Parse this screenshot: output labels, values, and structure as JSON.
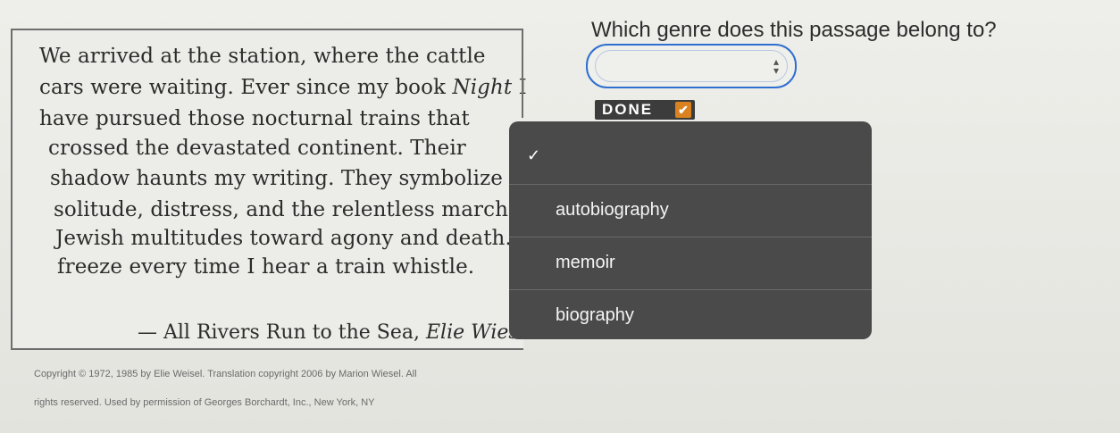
{
  "passage": {
    "lines": [
      {
        "plain": "We arrived at the station, where the cattle"
      },
      {
        "plain": "cars were waiting. Ever since my book ",
        "italic": "Night",
        "after": " I"
      },
      {
        "plain": "have pursued those nocturnal trains that"
      },
      {
        "plain": "crossed the devastated continent. Their"
      },
      {
        "plain": "shadow haunts my writing. They symbolize"
      },
      {
        "plain": "solitude, distress, and the relentless march o"
      },
      {
        "plain": "Jewish multitudes toward agony and death."
      },
      {
        "plain": "freeze every time I hear a train whistle."
      }
    ],
    "attribution_prefix": "— All Rivers Run to the Sea, ",
    "attribution_author": "Elie Wies"
  },
  "question": {
    "text": "Which genre does this passage belong to?",
    "select_value": ""
  },
  "done_button": {
    "label": "DONE"
  },
  "dropdown": {
    "options": [
      {
        "label": "",
        "selected": true
      },
      {
        "label": "autobiography"
      },
      {
        "label": "memoir"
      },
      {
        "label": "biography"
      }
    ]
  },
  "footer": {
    "line1": "Copyright © 1972, 1985 by Elie Weisel. Translation copyright 2006 by Marion Wiesel. All",
    "line2": "rights reserved. Used by permission of Georges Borchardt, Inc., New York, NY"
  },
  "colors": {
    "accent": "#2f6fd0",
    "done_check": "#d9821f",
    "dropdown_bg": "#4a4a4a"
  }
}
